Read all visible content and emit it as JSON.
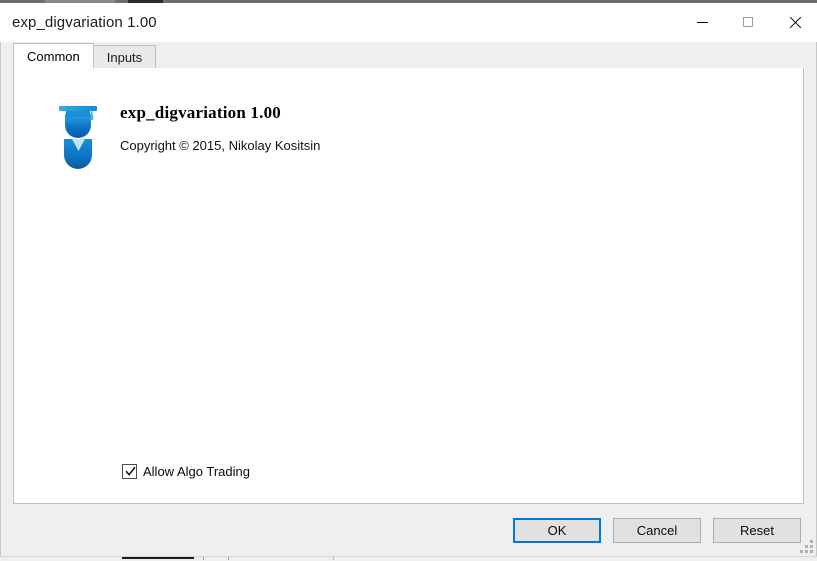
{
  "window": {
    "title": "exp_digvariation 1.00",
    "controls": {
      "minimize_label": "Minimize",
      "maximize_label": "Maximize",
      "close_label": "Close"
    }
  },
  "tabs": [
    {
      "label": "Common",
      "active": true
    },
    {
      "label": "Inputs",
      "active": false
    }
  ],
  "common_tab": {
    "product_name": "exp_digvariation 1.00",
    "copyright": "Copyright © 2015, Nikolay Kositsin",
    "icon_name": "graduate-expert-icon",
    "allow_algo_trading": {
      "label": "Allow Algo Trading",
      "checked": true
    }
  },
  "footer": {
    "ok_label": "OK",
    "cancel_label": "Cancel",
    "reset_label": "Reset"
  },
  "colors": {
    "accent": "#0078d7",
    "chrome": "#efefef",
    "panel": "#ffffff",
    "border": "#bfbfbf",
    "icon_blue": "#0c7fd4",
    "icon_blue_dark": "#0a5fa8",
    "icon_blue_light": "#35a8e8"
  }
}
